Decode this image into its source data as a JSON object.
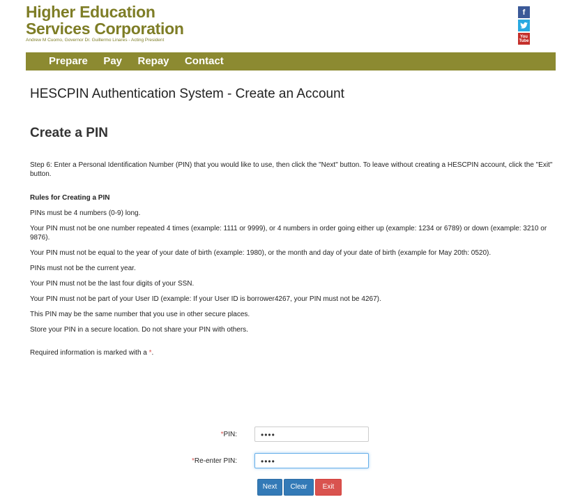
{
  "header": {
    "org_line1": "Higher Education",
    "org_line2": "Services Corporation",
    "org_sub": "Andrew M Cuomo, Governor    Dr. Guillermo Linares - Acting President",
    "social": [
      {
        "name": "facebook-icon",
        "glyph": "f"
      },
      {
        "name": "twitter-icon",
        "glyph": "t"
      },
      {
        "name": "youtube-icon",
        "glyph_top": "You",
        "glyph_bottom": "Tube"
      }
    ]
  },
  "nav": {
    "items": [
      "Prepare",
      "Pay",
      "Repay",
      "Contact"
    ]
  },
  "page": {
    "title": "HESCPIN Authentication System - Create an Account",
    "section_title": "Create a PIN",
    "step_text": "Step 6: Enter a Personal Identification Number (PIN) that you would like to use, then click the \"Next\" button. To leave without creating a HESCPIN account, click the \"Exit\" button.",
    "rules_heading": "Rules for Creating a PIN",
    "rules": [
      "PINs must be 4 numbers (0-9) long.",
      "Your PIN must not be one number repeated 4 times (example: 1111 or 9999), or 4 numbers in order going either up (example: 1234 or 6789) or down (example: 3210 or 9876).",
      "Your PIN must not be equal to the year of your date of birth (example: 1980), or the month and day of your date of birth (example for May 20th: 0520).",
      "PINs must not be the current year.",
      "Your PIN must not be the last four digits of your SSN.",
      "Your PIN must not be part of your User ID (example: If your User ID is borrower4267, your PIN must not be 4267).",
      "This PIN may be the same number that you use in other secure places.",
      "Store your PIN in a secure location. Do not share your PIN with others."
    ],
    "required_text": "Required information is marked with a",
    "required_star": "*",
    "required_end": "."
  },
  "form": {
    "pin_label": "PIN:",
    "pin_value": "••••",
    "reenter_label": "Re-enter PIN:",
    "reenter_value": "••••",
    "star": "*"
  },
  "buttons": {
    "next": "Next",
    "clear": "Clear",
    "exit": "Exit"
  },
  "colors": {
    "brand": "#8c8a31",
    "primary": "#337ab7",
    "danger": "#d9534f"
  }
}
